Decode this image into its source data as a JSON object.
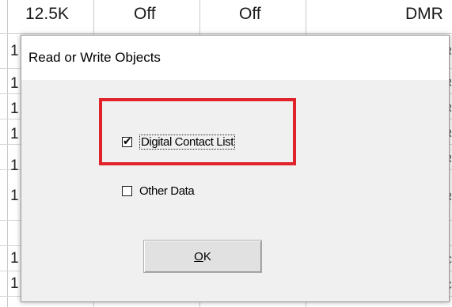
{
  "background_table": {
    "header_cells": [
      "12.5K",
      "Off",
      "Off",
      "DMR"
    ],
    "row_numbers": [
      "1",
      "1",
      "1",
      "1",
      "1",
      "1",
      "1",
      "1"
    ],
    "right_edge_letters": [
      "R",
      "R",
      "R",
      "R",
      "R",
      "R",
      "C",
      "C"
    ]
  },
  "dialog": {
    "title": "Read or Write Objects",
    "options": [
      {
        "label": "Digital Contact List",
        "checked": true
      },
      {
        "label": "Other Data",
        "checked": false
      }
    ],
    "ok_button": {
      "accel": "O",
      "rest": "K"
    },
    "highlight_color": "#e0232b"
  },
  "check_mark_glyph": "✔"
}
